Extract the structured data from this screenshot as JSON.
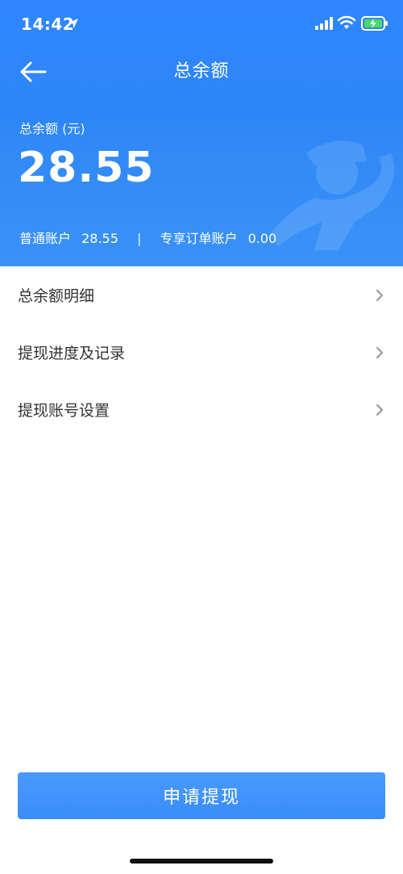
{
  "status_bar": {
    "time": "14:42",
    "icons": [
      "location-arrow-icon",
      "cellular-signal-icon",
      "wifi-icon",
      "battery-charging-icon"
    ]
  },
  "nav": {
    "title": "总余额",
    "back_icon": "arrow-left-icon"
  },
  "balance": {
    "label": "总余额 (元)",
    "amount": "28.55"
  },
  "accounts": {
    "regular_label": "普通账户",
    "regular_value": "28.55",
    "separator": "|",
    "exclusive_label": "专享订单账户",
    "exclusive_value": "0.00"
  },
  "menu": {
    "items": [
      {
        "label": "总余额明细",
        "icon": "chevron-right-icon"
      },
      {
        "label": "提现进度及记录",
        "icon": "chevron-right-icon"
      },
      {
        "label": "提现账号设置",
        "icon": "chevron-right-icon"
      }
    ]
  },
  "actions": {
    "apply_label": "申请提现"
  },
  "colors": {
    "primary": "#2f86ff",
    "button": "#3a8cf7",
    "text": "#333333",
    "chevron": "#999999"
  }
}
